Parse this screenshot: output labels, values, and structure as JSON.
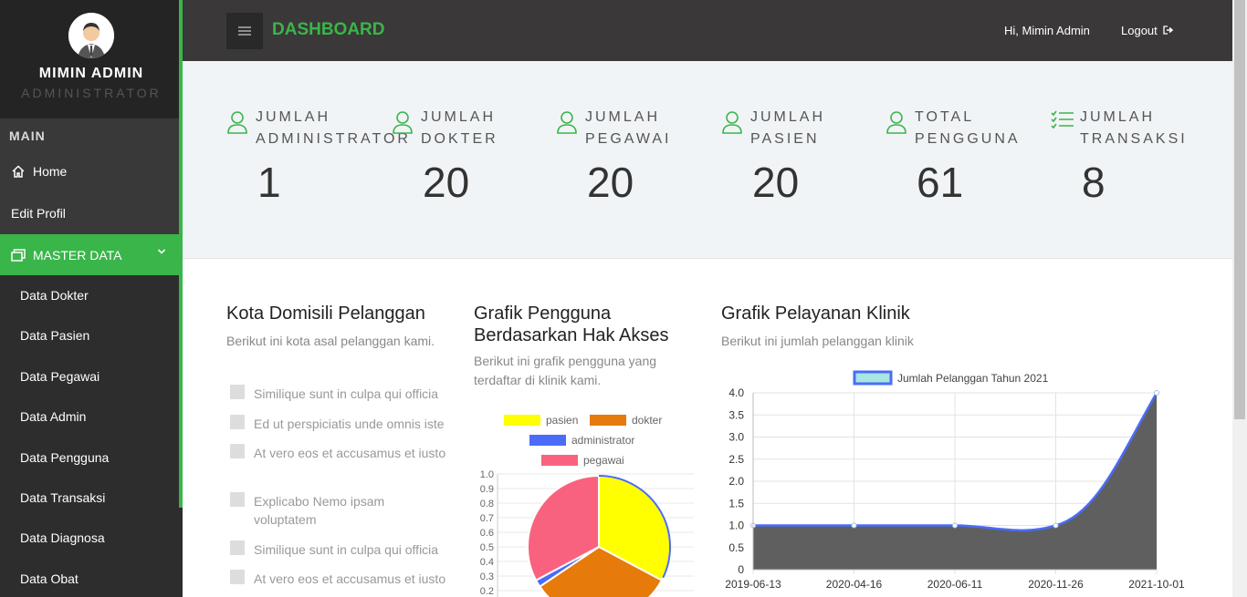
{
  "user": {
    "name": "MIMIN ADMIN",
    "role": "ADMINISTRATOR"
  },
  "nav": {
    "section": "MAIN",
    "home": "Home",
    "edit_profil": "Edit Profil",
    "master": "MASTER DATA",
    "sub_items": [
      "Data Dokter",
      "Data Pasien",
      "Data Pegawai",
      "Data Admin",
      "Data Pengguna",
      "Data Transaksi",
      "Data Diagnosa",
      "Data Obat"
    ]
  },
  "topbar": {
    "title": "DASHBOARD",
    "greeting": "Hi, Mimin Admin",
    "logout": "Logout"
  },
  "stats": [
    {
      "line1": "JUMLAH",
      "line2": "ADMINISTRATOR",
      "value": "1"
    },
    {
      "line1": "JUMLAH",
      "line2": "DOKTER",
      "value": "20"
    },
    {
      "line1": "JUMLAH",
      "line2": "PEGAWAI",
      "value": "20"
    },
    {
      "line1": "JUMLAH",
      "line2": "PASIEN",
      "value": "20"
    },
    {
      "line1": "TOTAL",
      "line2": "PENGGUNA",
      "value": "61"
    },
    {
      "line1": "JUMLAH",
      "line2": "TRANSAKSI",
      "value": "8"
    }
  ],
  "kota": {
    "title": "Kota Domisili Pelanggan",
    "subtitle": "Berikut ini kota asal pelanggan kami.",
    "items": [
      "Similique sunt in culpa qui officia",
      "Ed ut perspiciatis unde omnis iste",
      "At vero eos et accusamus et iusto",
      "Explicabo Nemo ipsam voluptatem",
      "Similique sunt in culpa qui officia",
      "At vero eos et accusamus et iusto"
    ]
  },
  "pengguna": {
    "title_l1": "Grafik Pengguna",
    "title_l2": "Berdasarkan Hak Akses",
    "subtitle_l1": "Berikut ini grafik pengguna yang",
    "subtitle_l2": "terdaftar di klinik kami."
  },
  "pelayanan": {
    "title": "Grafik Pelayanan Klinik",
    "subtitle": "Berikut ini jumlah pelanggan klinik"
  },
  "chart_data": [
    {
      "type": "pie",
      "labels": [
        "pasien",
        "dokter",
        "administrator",
        "pegawai"
      ],
      "values": [
        20,
        20,
        1,
        20
      ],
      "colors": [
        "#ffff00",
        "#e67a0a",
        "#4a6cf7",
        "#f9627e"
      ],
      "ytick_labels": [
        "1.0",
        "0.9",
        "0.8",
        "0.7",
        "0.6",
        "0.5",
        "0.4",
        "0.3",
        "0.2"
      ]
    },
    {
      "type": "area",
      "series_name": "Jumlah Pelanggan Tahun 2021",
      "x": [
        "2019-06-13",
        "2020-04-16",
        "2020-06-11",
        "2020-11-26",
        "2021-10-01"
      ],
      "values": [
        1,
        1,
        1,
        1,
        4
      ],
      "ylim": [
        0,
        4
      ],
      "yticks": [
        "4.0",
        "3.5",
        "3.0",
        "2.5",
        "2.0",
        "1.5",
        "1.0",
        "0.5",
        "0"
      ],
      "line_color": "#4a6cf7",
      "fill_color": "#5f5f5f"
    }
  ]
}
